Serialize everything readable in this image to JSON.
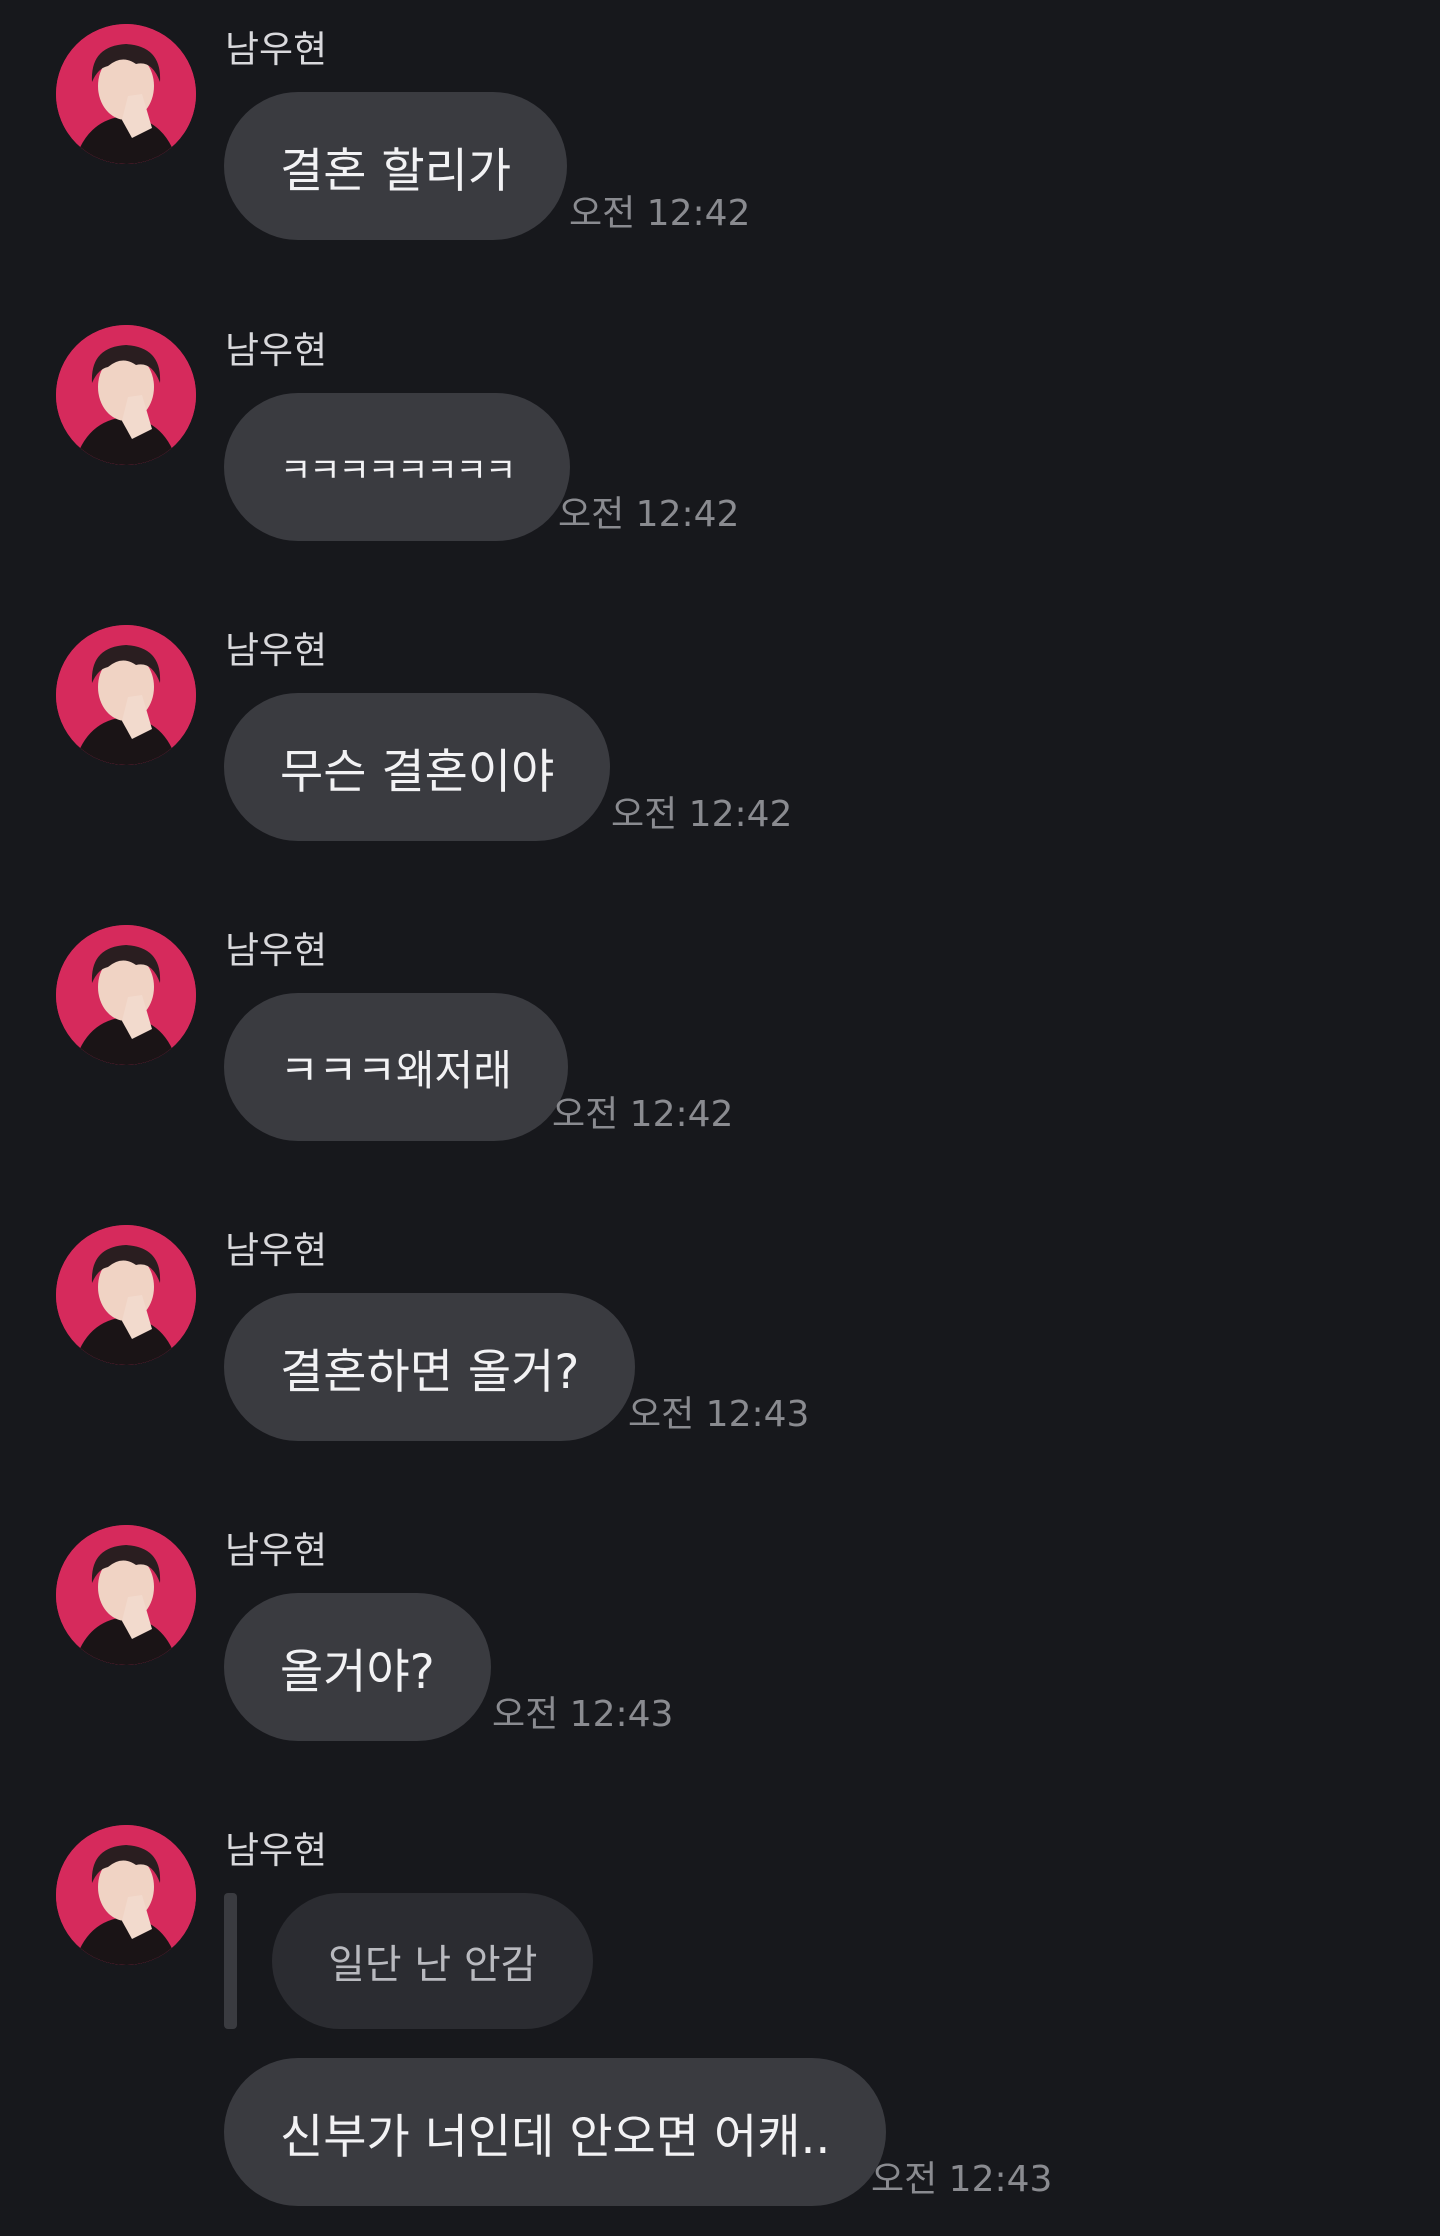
{
  "sender_name": "남우현",
  "messages": [
    {
      "text": "결혼 할리가",
      "time": "오전 12:42"
    },
    {
      "text": "ㅋㅋㅋㅋㅋㅋㅋㅋ",
      "time": "오전 12:42"
    },
    {
      "text": "무슨 결혼이야",
      "time": "오전 12:42"
    },
    {
      "text": "ㅋㅋㅋ왜저래",
      "time": "오전 12:42"
    },
    {
      "text": "결혼하면 올거?",
      "time": "오전 12:43"
    },
    {
      "text": "올거야?",
      "time": "오전 12:43"
    },
    {
      "text": "신부가 너인데 안오면 어캐..",
      "time": "오전 12:43",
      "reply_to": "일단 난 안감"
    }
  ],
  "colors": {
    "background": "#17181c",
    "bubble": "#3a3b40",
    "reply_bubble": "#2b2c31",
    "avatar_bg": "#d62a5c",
    "time_text": "#8a8b90"
  }
}
